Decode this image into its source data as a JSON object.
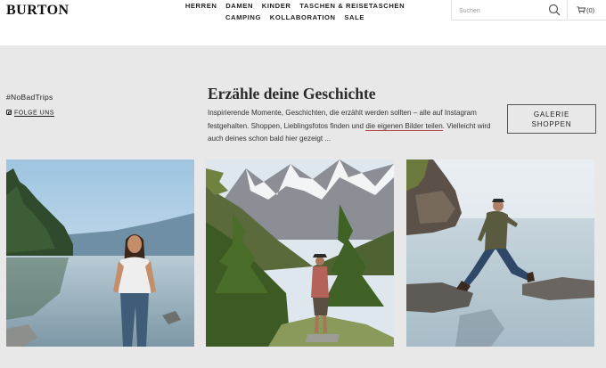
{
  "header": {
    "logo": "BURTON",
    "nav": [
      "HERREN",
      "DAMEN",
      "KINDER",
      "TASCHEN & REISETASCHEN",
      "CAMPING",
      "KOLLABORATION",
      "SALE"
    ],
    "search_placeholder": "Suchen",
    "cart_label": "(0)"
  },
  "section": {
    "hashtag": "#NoBadTrips",
    "follow_label": "FOLGE UNS",
    "title": "Erzähle deine Geschichte",
    "desc_part1": "Inspirierende Momente, Geschichten, die erzählt werden sollten – alle auf Instagram festgehalten. Shoppen, Lieblingsfotos finden und ",
    "desc_link": "die eigenen Bilder teilen",
    "desc_part2": ". Vielleicht wird auch deines schon bald hier gezeigt ...",
    "gallery_button_line1": "GALERIE",
    "gallery_button_line2": "SHOPPEN"
  },
  "icons": {
    "search": "search-icon",
    "cart": "cart-icon",
    "instagram": "instagram-icon"
  },
  "colors": {
    "section_bg": "#e8e8e8",
    "link_underline": "#b34a4a"
  }
}
